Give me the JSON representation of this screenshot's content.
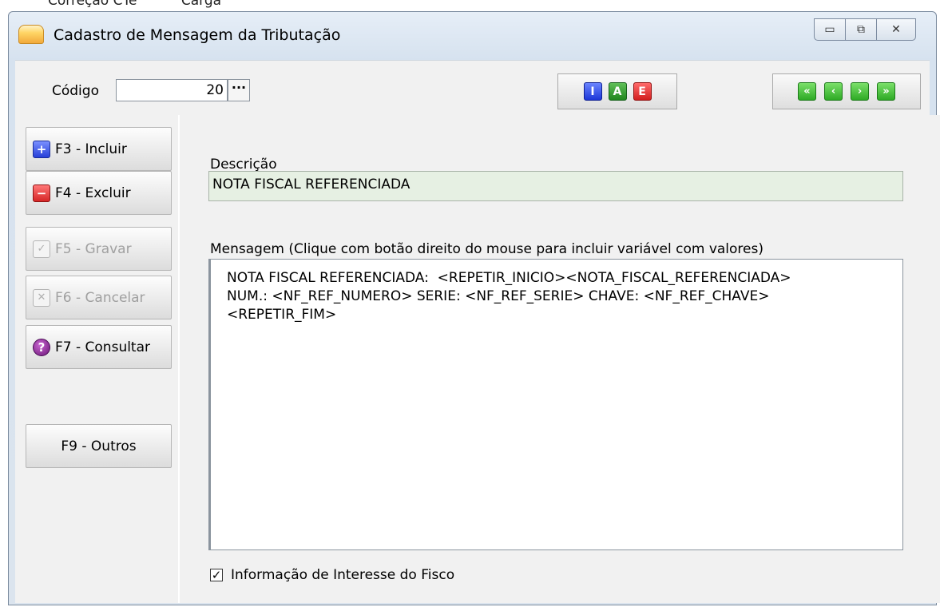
{
  "background_menu": [
    "Correção CTe",
    "Carga"
  ],
  "window": {
    "title": "Cadastro de Mensagem da Tributação",
    "controls": {
      "minimize": "▭",
      "restore": "⧉",
      "close": "✕"
    }
  },
  "toolbar": {
    "codigo_label": "Código",
    "codigo_value": "20",
    "lookup_label": "···",
    "mode_buttons": [
      "I",
      "A",
      "E"
    ],
    "nav_buttons": [
      "«",
      "‹",
      "›",
      "»"
    ]
  },
  "sidebar": {
    "buttons": [
      {
        "label": "F3 - Incluir",
        "icon": "plus-icon",
        "enabled": true
      },
      {
        "label": "F4 - Excluir",
        "icon": "minus-icon",
        "enabled": true
      },
      {
        "label": "F5 - Gravar",
        "icon": "check-icon",
        "enabled": false
      },
      {
        "label": "F6 - Cancelar",
        "icon": "x-icon",
        "enabled": false
      },
      {
        "label": "F7 - Consultar",
        "icon": "help-icon",
        "enabled": true
      },
      {
        "label": "F9 - Outros",
        "icon": "",
        "enabled": true
      }
    ]
  },
  "form": {
    "descricao_label": "Descrição",
    "descricao_value": "NOTA FISCAL REFERENCIADA",
    "mensagem_label": "Mensagem (Clique com botão direito do mouse para incluir variável com valores)",
    "mensagem_value": "NOTA FISCAL REFERENCIADA:  <REPETIR_INICIO><NOTA_FISCAL_REFERENCIADA>\nNUM.: <NF_REF_NUMERO> SERIE: <NF_REF_SERIE> CHAVE: <NF_REF_CHAVE>\n<REPETIR_FIM>",
    "fisco_checkbox_checked": true,
    "fisco_checkbox_mark": "✓",
    "fisco_label": "Informação de Interesse do Fisco"
  },
  "colors": {
    "descricao_bg": "#e6f0e3",
    "window_bg": "#d6e2ef",
    "panel_bg": "#f1f1f1"
  }
}
